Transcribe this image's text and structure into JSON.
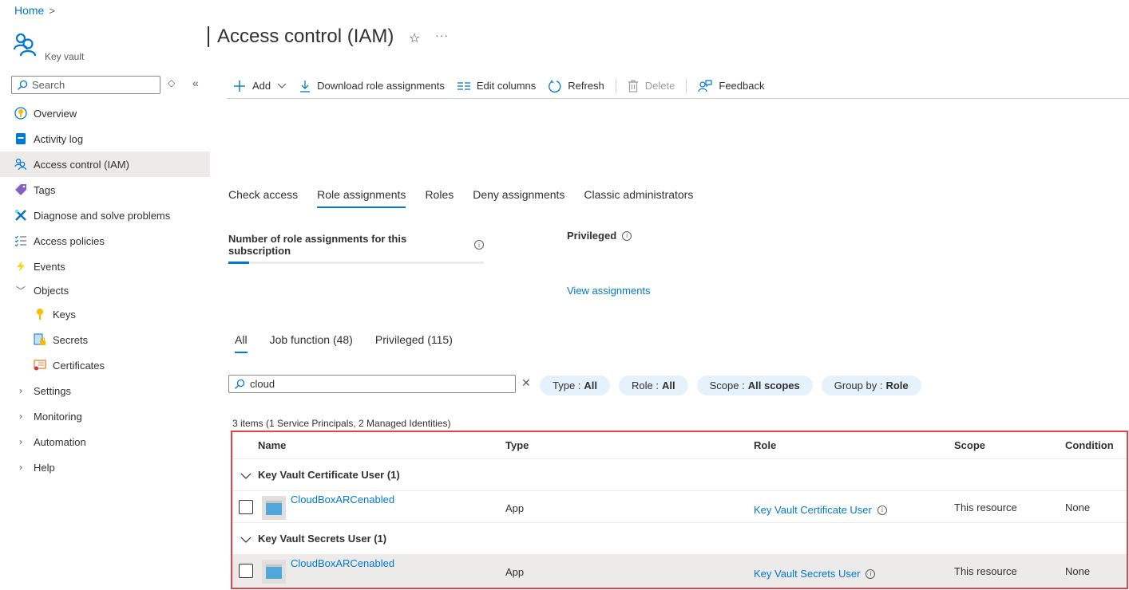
{
  "breadcrumb": {
    "home": "Home",
    "separator": ">"
  },
  "resource": {
    "type_label": "Key vault"
  },
  "page": {
    "title": "Access control (IAM)",
    "favorite_icon": "star-icon",
    "more_icon": "ellipsis-icon"
  },
  "sidebar": {
    "search_placeholder": "Search",
    "items": [
      {
        "label": "Overview",
        "icon": "overview-icon",
        "active": false
      },
      {
        "label": "Activity log",
        "icon": "activity-log-icon",
        "active": false
      },
      {
        "label": "Access control (IAM)",
        "icon": "iam-icon",
        "active": true
      },
      {
        "label": "Tags",
        "icon": "tag-icon",
        "active": false
      },
      {
        "label": "Diagnose and solve problems",
        "icon": "wrench-icon",
        "active": false
      },
      {
        "label": "Access policies",
        "icon": "checklist-icon",
        "active": false
      },
      {
        "label": "Events",
        "icon": "lightning-icon",
        "active": false
      },
      {
        "label": "Objects",
        "expandable": true,
        "expanded": true
      },
      {
        "label": "Keys",
        "icon": "key-icon",
        "child": true
      },
      {
        "label": "Secrets",
        "icon": "secret-icon",
        "child": true
      },
      {
        "label": "Certificates",
        "icon": "certificate-icon",
        "child": true
      },
      {
        "label": "Settings",
        "expandable": true,
        "expanded": false
      },
      {
        "label": "Monitoring",
        "expandable": true,
        "expanded": false
      },
      {
        "label": "Automation",
        "expandable": true,
        "expanded": false
      },
      {
        "label": "Help",
        "expandable": true,
        "expanded": false
      }
    ]
  },
  "toolbar": {
    "add": "Add",
    "download": "Download role assignments",
    "edit_columns": "Edit columns",
    "refresh": "Refresh",
    "delete": "Delete",
    "feedback": "Feedback"
  },
  "tabs": [
    {
      "label": "Check access",
      "active": false
    },
    {
      "label": "Role assignments",
      "active": true
    },
    {
      "label": "Roles",
      "active": false
    },
    {
      "label": "Deny assignments",
      "active": false
    },
    {
      "label": "Classic administrators",
      "active": false
    }
  ],
  "stats": {
    "count_label": "Number of role assignments for this subscription",
    "count_progress_fraction": 0.08,
    "privileged_label": "Privileged",
    "view_assignments": "View assignments"
  },
  "filter_tabs": [
    {
      "label": "All",
      "active": true
    },
    {
      "label": "Job function (48)",
      "active": false
    },
    {
      "label": "Privileged (115)",
      "active": false
    }
  ],
  "search": {
    "value": "cloud"
  },
  "filters": [
    {
      "key": "Type :",
      "value": "All"
    },
    {
      "key": "Role :",
      "value": "All"
    },
    {
      "key": "Scope :",
      "value": "All scopes"
    },
    {
      "key": "Group by :",
      "value": "Role"
    }
  ],
  "items_summary": "3 items (1 Service Principals, 2 Managed Identities)",
  "table": {
    "columns": [
      "Name",
      "Type",
      "Role",
      "Scope",
      "Condition"
    ],
    "groups": [
      {
        "title": "Key Vault Certificate User (1)",
        "rows": [
          {
            "name": "CloudBoxARCenabled",
            "type": "App",
            "role": "Key Vault Certificate User",
            "scope": "This resource",
            "condition": "None"
          }
        ]
      },
      {
        "title": "Key Vault Secrets User (1)",
        "rows": [
          {
            "name": "CloudBoxARCenabled",
            "type": "App",
            "role": "Key Vault Secrets User",
            "scope": "This resource",
            "condition": "None"
          }
        ]
      }
    ]
  },
  "colors": {
    "accent": "#0078d4",
    "highlight_border": "#e8414a",
    "pill_bg": "#e5f1fb",
    "selected_bg": "#edebe9"
  }
}
